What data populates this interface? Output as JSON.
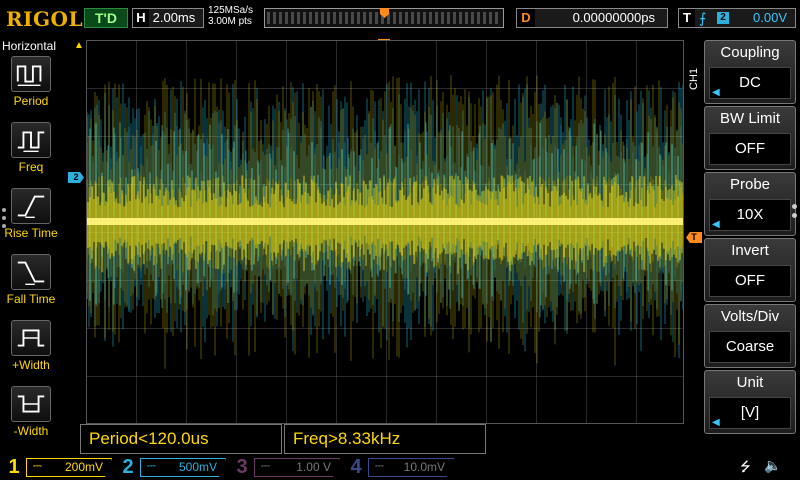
{
  "header": {
    "logo": "RIGOL",
    "run_status": "T'D",
    "horizontal": {
      "key": "H",
      "value": "2.00ms"
    },
    "sample_rate": "125MSa/s",
    "memory_depth": "3.00M pts",
    "delay": {
      "key": "D",
      "value": "0.00000000ps"
    },
    "trigger": {
      "key": "T",
      "edge_icon": "rising-edge-icon",
      "source": "2",
      "level": "0.00V"
    }
  },
  "left_menu": {
    "title": "Horizontal",
    "items": [
      {
        "label": "Period",
        "icon": "period-icon"
      },
      {
        "label": "Freq",
        "icon": "freq-icon"
      },
      {
        "label": "Rise Time",
        "icon": "rise-time-icon"
      },
      {
        "label": "Fall Time",
        "icon": "fall-time-icon"
      },
      {
        "label": "+Width",
        "icon": "pos-width-icon"
      },
      {
        "label": "-Width",
        "icon": "neg-width-icon"
      }
    ]
  },
  "screen": {
    "ch2_marker": "2",
    "trigger_pos_marker": "T",
    "trigger_level_marker": "T",
    "side_label": "CH1",
    "colors": {
      "ch1": "#ffe100",
      "ch2": "#27b6d6",
      "trigger": "#ff8a1e"
    }
  },
  "measurements": [
    {
      "text": "Period<120.0us"
    },
    {
      "text": "Freq>8.33kHz"
    }
  ],
  "right_menu": {
    "items": [
      {
        "title": "Coupling",
        "value": "DC"
      },
      {
        "title": "BW Limit",
        "value": "OFF"
      },
      {
        "title": "Probe",
        "value": "10X"
      },
      {
        "title": "Invert",
        "value": "OFF"
      },
      {
        "title": "Volts/Div",
        "value": "Coarse"
      },
      {
        "title": "Unit",
        "value": "[V]"
      }
    ]
  },
  "channels": [
    {
      "num": "1",
      "scale": "200mV",
      "color": "#ffd800",
      "active": true
    },
    {
      "num": "2",
      "scale": "500mV",
      "color": "#2bb0e0",
      "active": true
    },
    {
      "num": "3",
      "scale": "1.00 V",
      "color": "#c03ab0",
      "active": false
    },
    {
      "num": "4",
      "scale": "10.0mV",
      "color": "#3050d0",
      "active": false
    }
  ],
  "status_icons": {
    "usb": "usb-icon",
    "sound": "speaker-mute-icon"
  }
}
